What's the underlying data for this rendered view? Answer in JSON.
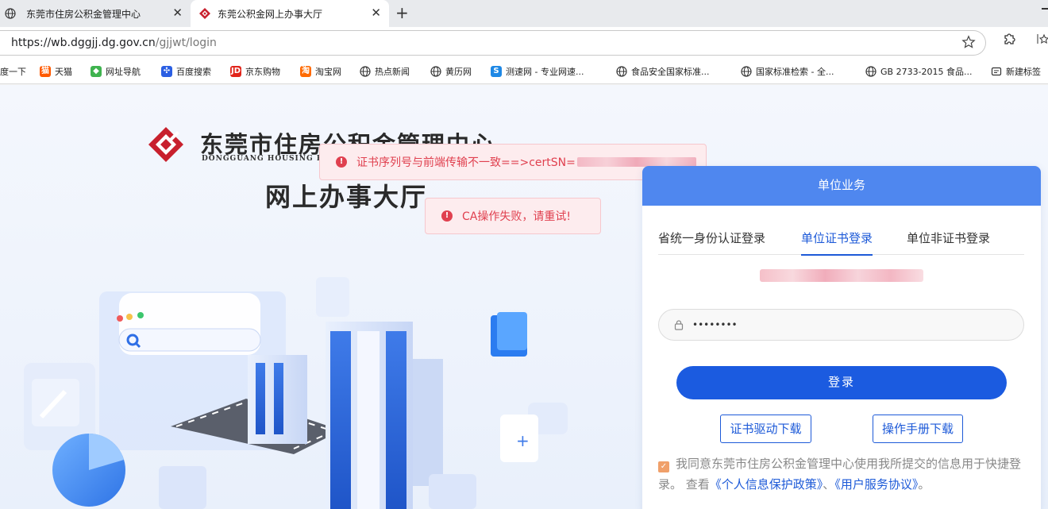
{
  "browser": {
    "tabs": [
      {
        "title": "东莞市住房公积金管理中心",
        "active": false
      },
      {
        "title": "东莞公积金网上办事大厅",
        "active": true
      }
    ],
    "close_glyph": "✕",
    "new_tab_glyph": "+",
    "url_main": "https://wb.dggjj.dg.gov.cn",
    "url_path": "/gjjwt/login",
    "bookmarks": [
      {
        "label": "度一下",
        "icon": "baidu-icon"
      },
      {
        "label": "天猫",
        "icon": "tmall-icon"
      },
      {
        "label": "网址导航",
        "icon": "nav-icon"
      },
      {
        "label": "百度搜索",
        "icon": "baidu-paw-icon"
      },
      {
        "label": "京东购物",
        "icon": "jd-icon"
      },
      {
        "label": "淘宝网",
        "icon": "taobao-icon"
      },
      {
        "label": "热点新闻",
        "icon": "globe-icon"
      },
      {
        "label": "黄历网",
        "icon": "globe-icon"
      },
      {
        "label": "测速网 - 专业网速...",
        "icon": "speedtest-icon"
      },
      {
        "label": "食品安全国家标准...",
        "icon": "globe-icon"
      },
      {
        "label": "国家标准检索 - 全...",
        "icon": "globe-icon"
      },
      {
        "label": "GB 2733-2015 食品...",
        "icon": "globe-icon"
      },
      {
        "label": "新建标签",
        "icon": "folder-icon"
      }
    ]
  },
  "header": {
    "org_name": "东莞市住房公积金管理中心",
    "org_name_en": "DONGGUANG HOUSING PROVIDENT FUND",
    "hall_title": "网上办事大厅"
  },
  "toasts": [
    {
      "text": "证书序列号与前端传输不一致==>certSN="
    },
    {
      "text": "CA操作失败，请重试!"
    }
  ],
  "login": {
    "panel_title": "单位业务",
    "tabs": [
      {
        "label": "省统一身份认证登录",
        "active": false
      },
      {
        "label": "单位证书登录",
        "active": true
      },
      {
        "label": "单位非证书登录",
        "active": false
      }
    ],
    "password_mask": "••••••••",
    "login_label": "登录",
    "driver_download": "证书驱动下载",
    "manual_download": "操作手册下载",
    "agree_text": "我同意东莞市住房公积金管理中心使用我所提交的信息用于快捷登录。 查看",
    "privacy_link": "《个人信息保护政策》",
    "separator": "、",
    "service_link": "《用户服务协议》",
    "period": "。",
    "agree_checked": true
  },
  "colors": {
    "primary": "#1b5be0",
    "panel_head": "#4f87ef",
    "error": "#e0404f",
    "logo_red": "#c8202d"
  }
}
